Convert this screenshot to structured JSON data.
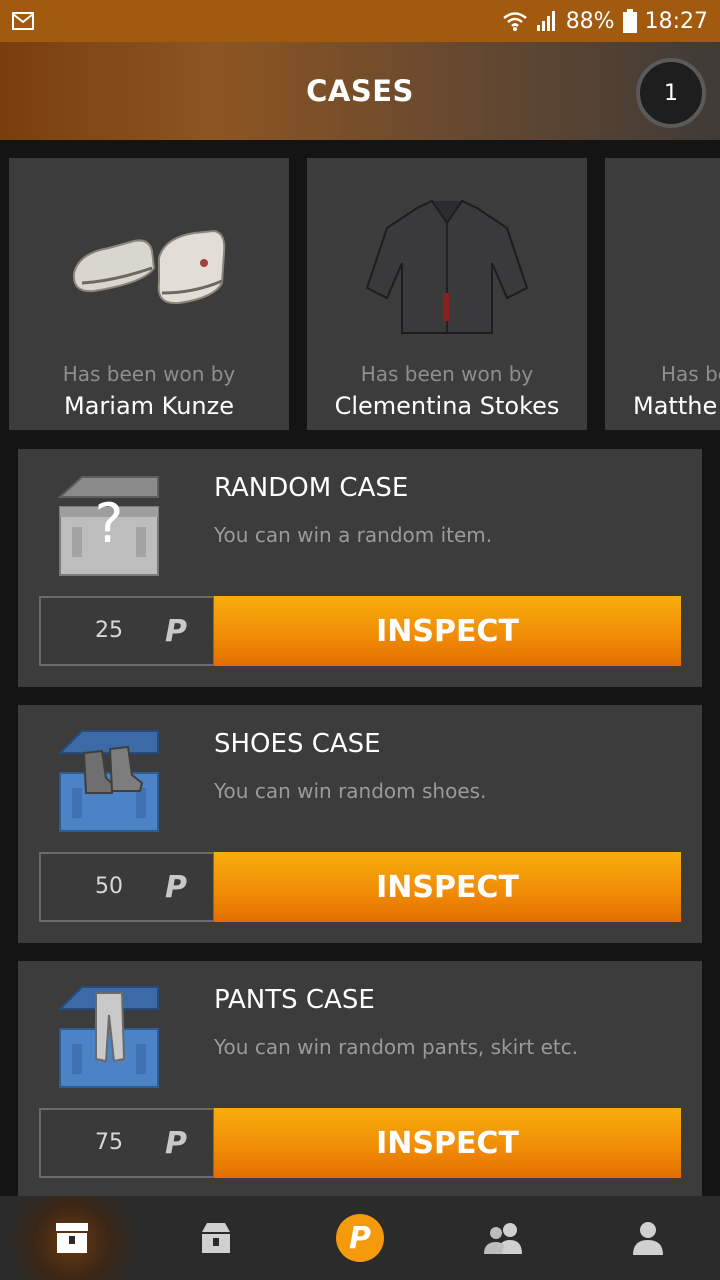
{
  "status": {
    "battery": "88%",
    "time": "18:27"
  },
  "header": {
    "title": "CASES",
    "badge_count": "1"
  },
  "winners": {
    "caption": "Has been won by",
    "items": [
      {
        "name": "Mariam Kunze",
        "item_icon": "shoes-icon"
      },
      {
        "name": "Clementina Stokes",
        "item_icon": "shirt-icon"
      },
      {
        "name": "Matthe",
        "item_icon": "tshirt-icon"
      }
    ]
  },
  "cases": [
    {
      "title": "RANDOM CASE",
      "description": "You can win a random item.",
      "price": "25",
      "button": "INSPECT"
    },
    {
      "title": "SHOES CASE",
      "description": "You can win random shoes.",
      "price": "50",
      "button": "INSPECT"
    },
    {
      "title": "PANTS CASE",
      "description": "You can win random pants, skirt etc.",
      "price": "75",
      "button": "INSPECT"
    }
  ],
  "currency_symbol": "P",
  "nav": {
    "items": [
      "cases-icon",
      "shop-icon",
      "points-icon",
      "friends-icon",
      "profile-icon"
    ],
    "coin_label": "P"
  },
  "colors": {
    "accent": "#f59a0a",
    "status_bar": "#a25a0e",
    "card": "#3c3c3c"
  }
}
